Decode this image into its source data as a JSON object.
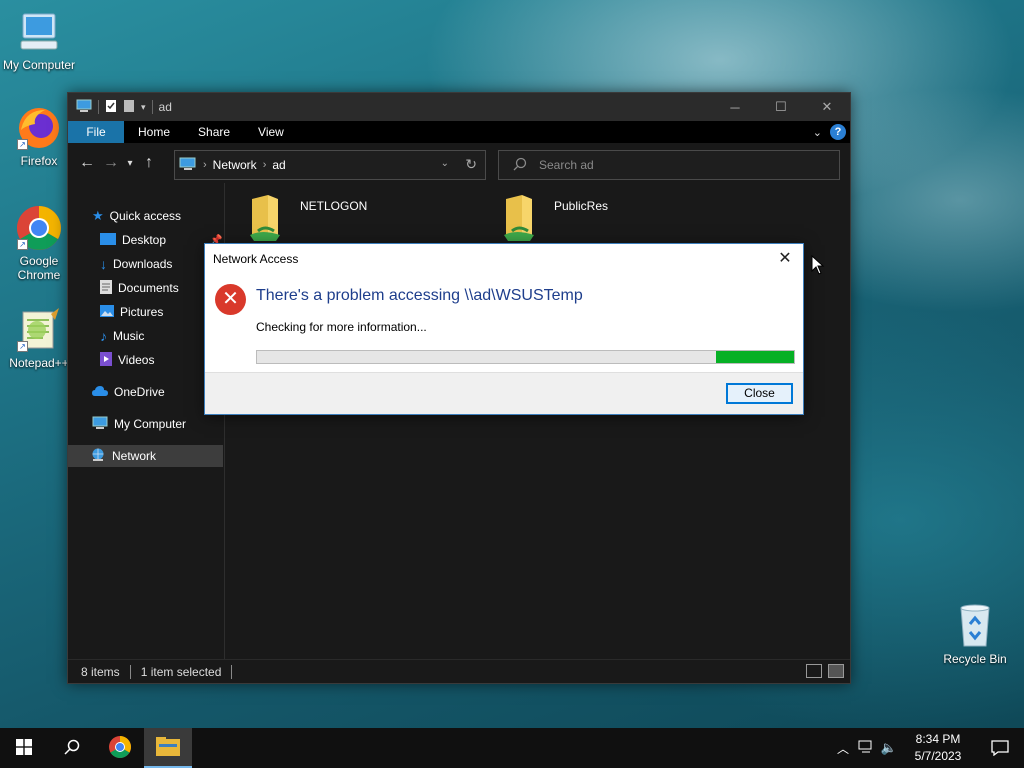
{
  "desktop": {
    "icons": [
      {
        "label": "My Computer",
        "icon": "computer-icon"
      },
      {
        "label": "Firefox",
        "icon": "firefox-icon"
      },
      {
        "label": "Google Chrome",
        "icon": "chrome-icon"
      },
      {
        "label": "Notepad++",
        "icon": "notepadpp-icon"
      },
      {
        "label": "Recycle Bin",
        "icon": "recycle-bin-icon"
      }
    ]
  },
  "explorer": {
    "title": "ad",
    "ribbon": {
      "tabs": [
        "File",
        "Home",
        "Share",
        "View"
      ]
    },
    "address": {
      "crumbs": [
        "Network",
        "ad"
      ]
    },
    "search": {
      "placeholder": "Search ad"
    },
    "sidebar": {
      "items": [
        {
          "label": "Quick access",
          "icon": "star-icon"
        },
        {
          "label": "Desktop",
          "icon": "desktop-icon"
        },
        {
          "label": "Downloads",
          "icon": "download-icon"
        },
        {
          "label": "Documents",
          "icon": "document-icon"
        },
        {
          "label": "Pictures",
          "icon": "pictures-icon"
        },
        {
          "label": "Music",
          "icon": "music-icon"
        },
        {
          "label": "Videos",
          "icon": "videos-icon"
        },
        {
          "label": "OneDrive",
          "icon": "cloud-icon"
        },
        {
          "label": "My Computer",
          "icon": "computer-icon"
        },
        {
          "label": "Network",
          "icon": "network-icon"
        }
      ],
      "selected": "Network"
    },
    "folders": [
      {
        "name": "NETLOGON",
        "icon": "shared-folder-icon"
      },
      {
        "name": "PublicRes",
        "icon": "shared-folder-icon"
      }
    ],
    "status": {
      "items": "8 items",
      "selected": "1 item selected"
    }
  },
  "dialog": {
    "title": "Network Access",
    "message": "There's a problem accessing \\\\ad\\WSUSTemp",
    "detail": "Checking for more information...",
    "progress": {
      "start": 0.855,
      "end": 1.0,
      "color": "#06b025"
    },
    "close_label": "Close"
  },
  "taskbar": {
    "apps": [
      "start-icon",
      "search-icon",
      "chrome-icon",
      "file-explorer-icon"
    ],
    "active_app": "file-explorer-icon",
    "clock": {
      "time": "8:34 PM",
      "date": "5/7/2023"
    }
  },
  "colors": {
    "accent": "#1a73a8",
    "error": "#d9392b",
    "progress": "#06b025"
  }
}
